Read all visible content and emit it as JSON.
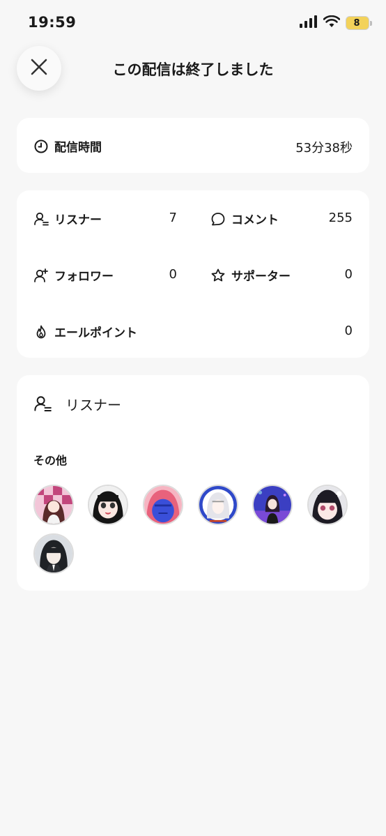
{
  "status_bar": {
    "time": "19:59",
    "battery": "8"
  },
  "header": {
    "title": "この配信は終了しました"
  },
  "duration": {
    "label": "配信時間",
    "value": "53分38秒"
  },
  "stats": {
    "listeners": {
      "label": "リスナー",
      "value": "7"
    },
    "comments": {
      "label": "コメント",
      "value": "255"
    },
    "followers": {
      "label": "フォロワー",
      "value": "0"
    },
    "supporters": {
      "label": "サポーター",
      "value": "0"
    },
    "cheer_points": {
      "label": "エールポイント",
      "value": "0"
    }
  },
  "listeners_section": {
    "title": "リスナー",
    "group_label": "その他",
    "avatars": [
      "avatar-1",
      "avatar-2",
      "avatar-3",
      "avatar-4",
      "avatar-5",
      "avatar-6",
      "avatar-7"
    ]
  },
  "colors": {
    "background": "#f7f7f7",
    "card": "#ffffff",
    "text": "#1a1a1a",
    "battery": "#f3d25a"
  }
}
